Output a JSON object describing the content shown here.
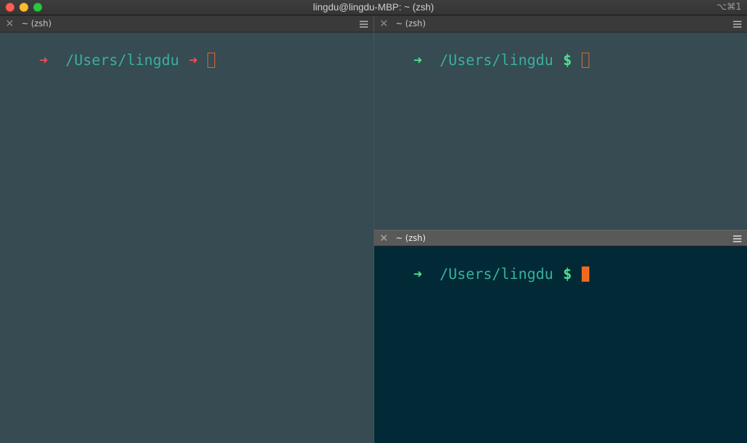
{
  "window": {
    "title": "lingdu@lingdu-MBP: ~ (zsh)",
    "shortcut": "⌥⌘1"
  },
  "colors": {
    "prompt_arrow_inactive": "#e5525a",
    "prompt_arrow_active": "#4fe28f",
    "path": "#3aaf9f",
    "cursor": "#f06a1e",
    "pane_bg": "#364b52",
    "active_pane_bg": "#012a36"
  },
  "panes": [
    {
      "tab_title": "~ (zsh)",
      "prompt_arrow": "➜",
      "path": "/Users/lingdu",
      "prompt_symbol": "➜",
      "active": false
    },
    {
      "tab_title": "~ (zsh)",
      "prompt_arrow": "➜",
      "path": "/Users/lingdu",
      "prompt_symbol": "$",
      "active": false
    },
    {
      "tab_title": "~ (zsh)",
      "prompt_arrow": "➜",
      "path": "/Users/lingdu",
      "prompt_symbol": "$",
      "active": true
    }
  ],
  "icons": {
    "close_tab": "close-icon",
    "menu": "hamburger-menu-icon"
  }
}
